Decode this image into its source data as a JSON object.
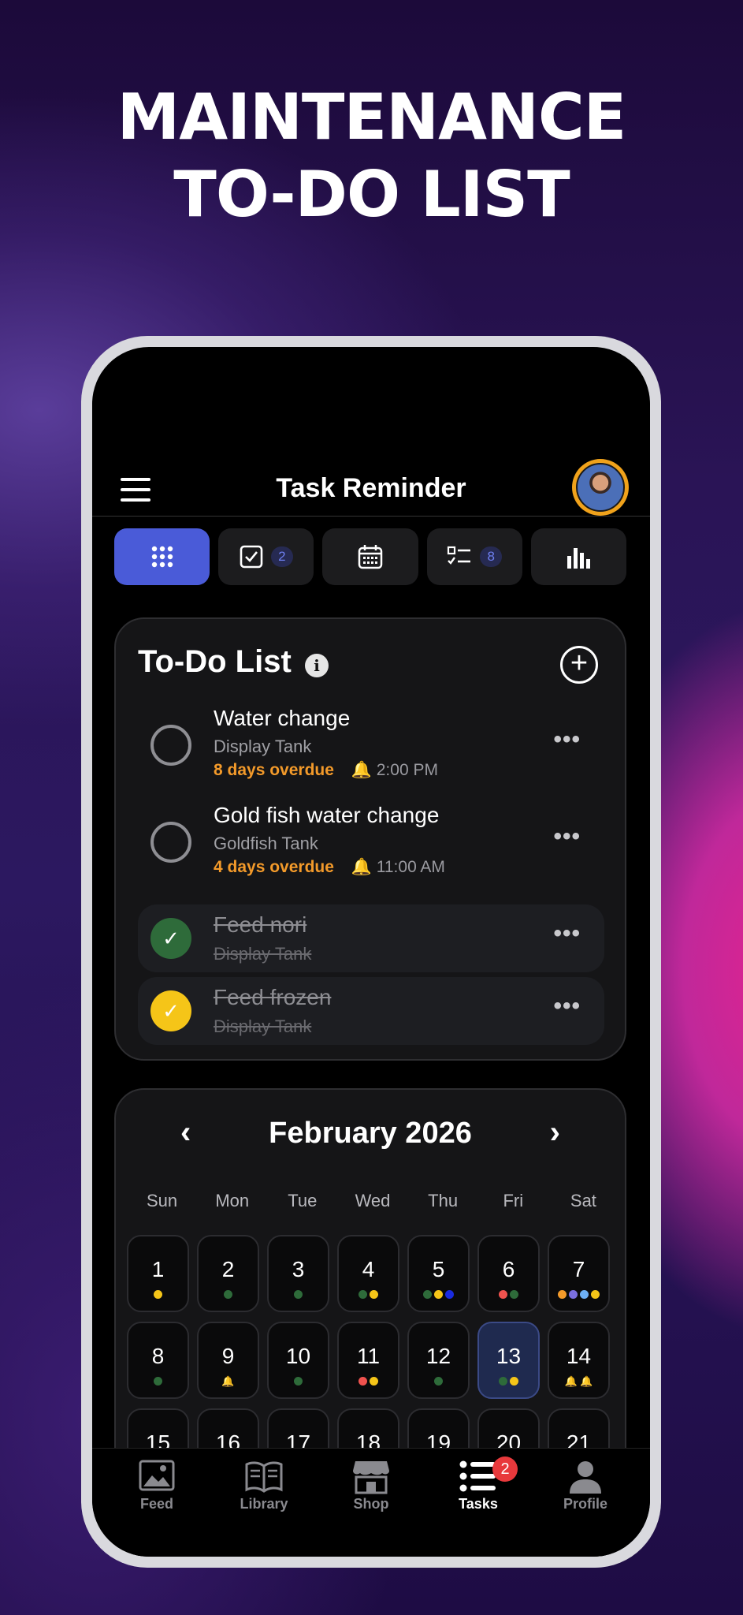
{
  "headline": {
    "line1": "MAINTENANCE",
    "line2": "TO-DO LIST"
  },
  "header": {
    "title": "Task Reminder",
    "menu_icon": "hamburger-icon",
    "avatar": "avatar"
  },
  "tabs": [
    {
      "icon": "grid-icon",
      "badge": "",
      "active": true
    },
    {
      "icon": "checkbox-icon",
      "badge": "2"
    },
    {
      "icon": "calendar-icon",
      "badge": ""
    },
    {
      "icon": "checklist-icon",
      "badge": "8"
    },
    {
      "icon": "bar-chart-icon",
      "badge": ""
    }
  ],
  "todo": {
    "title": "To-Do List",
    "info_glyph": "i",
    "add_glyph": "+",
    "more_glyph": "•••",
    "bell_glyph": "🔔",
    "check_glyph": "✓",
    "tasks": [
      {
        "name": "Water change",
        "tank": "Display Tank",
        "overdue": "8 days overdue",
        "time": "2:00 PM",
        "done": false
      },
      {
        "name": "Gold fish water change",
        "tank": "Goldfish Tank",
        "overdue": "4 days overdue",
        "time": "11:00 AM",
        "done": false
      },
      {
        "name": "Feed nori",
        "tank": "Display Tank",
        "done": true,
        "check_color": "#2e6b3a"
      },
      {
        "name": "Feed frozen",
        "tank": "Display Tank",
        "done": true,
        "check_color": "#f5c518"
      }
    ]
  },
  "calendar": {
    "month": "February 2026",
    "prev_glyph": "‹",
    "next_glyph": "›",
    "weekdays": [
      "Sun",
      "Mon",
      "Tue",
      "Wed",
      "Thu",
      "Fri",
      "Sat"
    ],
    "today": "13",
    "weeks": [
      [
        {
          "day": "1",
          "dots": [
            "#f5c518"
          ]
        },
        {
          "day": "2",
          "dots": [
            "#2e6b3a"
          ]
        },
        {
          "day": "3",
          "dots": [
            "#2e6b3a"
          ]
        },
        {
          "day": "4",
          "dots": [
            "#2e6b3a",
            "#f5c518"
          ]
        },
        {
          "day": "5",
          "dots": [
            "#2e6b3a",
            "#f5c518",
            "#1a2be0"
          ]
        },
        {
          "day": "6",
          "dots": [
            "#f0524e",
            "#2e6b3a"
          ]
        },
        {
          "day": "7",
          "dots": [
            "#f39a2a",
            "#7a6fe0",
            "#6db0f5",
            "#f5c518"
          ]
        }
      ],
      [
        {
          "day": "8",
          "dots": [
            "#2e6b3a"
          ]
        },
        {
          "day": "9",
          "dots": [
            "bell:#f39a2a"
          ]
        },
        {
          "day": "10",
          "dots": [
            "#2e6b3a"
          ]
        },
        {
          "day": "11",
          "dots": [
            "#f0524e",
            "#f5c518"
          ]
        },
        {
          "day": "12",
          "dots": [
            "#2e6b3a"
          ]
        },
        {
          "day": "13",
          "dots": [
            "#2e6b3a",
            "#f5c518"
          ]
        },
        {
          "day": "14",
          "dots": [
            "bell:#35c27a",
            "bell:#2e6b3a"
          ]
        }
      ],
      [
        {
          "day": "15",
          "dots": []
        },
        {
          "day": "16",
          "dots": []
        },
        {
          "day": "17",
          "dots": []
        },
        {
          "day": "18",
          "dots": []
        },
        {
          "day": "19",
          "dots": []
        },
        {
          "day": "20",
          "dots": []
        },
        {
          "day": "21",
          "dots": []
        }
      ]
    ]
  },
  "bottom_nav": {
    "items": [
      {
        "label": "Feed",
        "icon": "image-icon"
      },
      {
        "label": "Library",
        "icon": "book-icon"
      },
      {
        "label": "Shop",
        "icon": "storefront-icon"
      },
      {
        "label": "Tasks",
        "icon": "task-list-icon",
        "badge": "2",
        "active": true
      },
      {
        "label": "Profile",
        "icon": "person-icon"
      }
    ]
  },
  "colors": {
    "accent": "#4a5bd8",
    "overdue": "#f39a2a",
    "badge": "#e8393c",
    "avatar_ring": "#f0a21b"
  }
}
